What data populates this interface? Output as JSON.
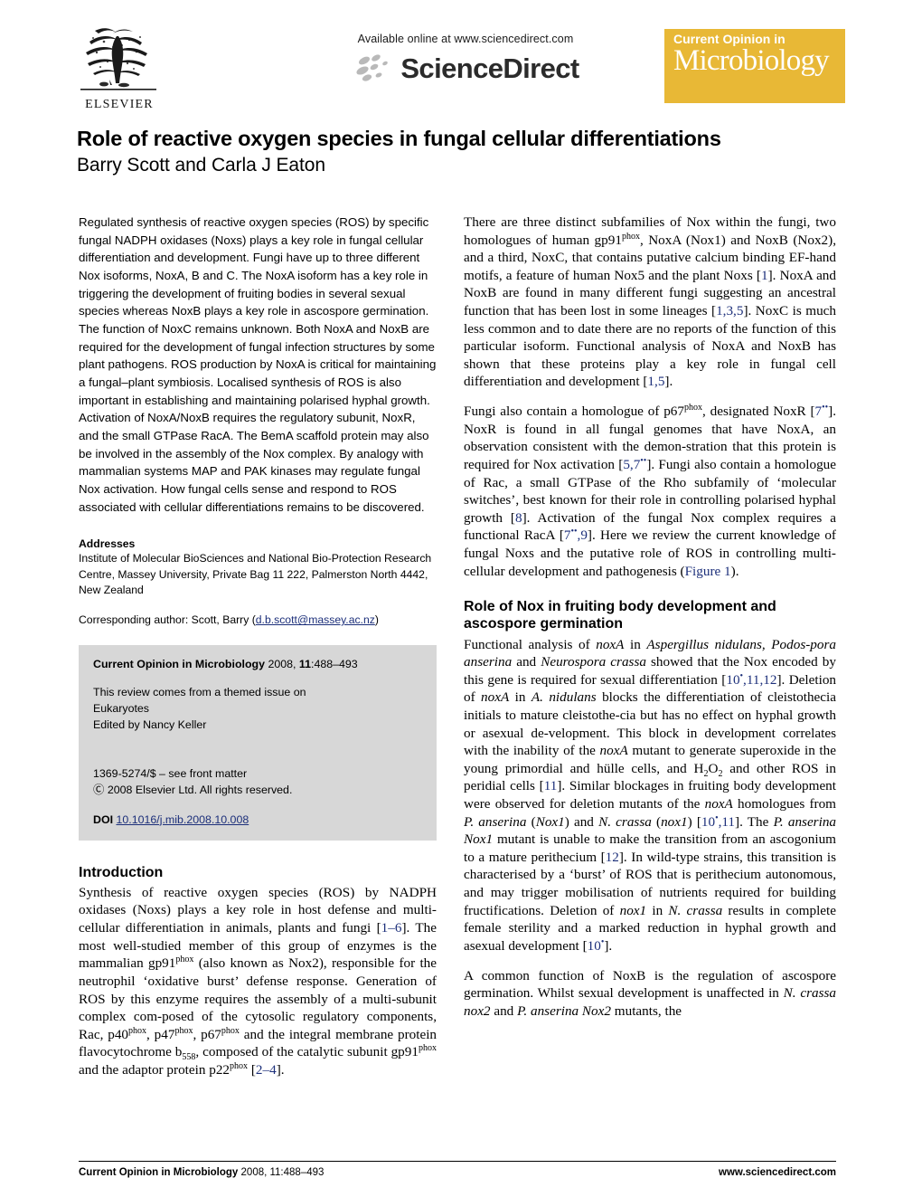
{
  "masthead": {
    "publisher": "ELSEVIER",
    "available_online": "Available online at www.sciencedirect.com",
    "sciencedirect_name": "ScienceDirect",
    "journal_badge_top": "Current Opinion in",
    "journal_badge_main": "Microbiology",
    "badge_color": "#e8b836"
  },
  "article": {
    "title": "Role of reactive oxygen species in fungal cellular differentiations",
    "authors": "Barry Scott and Carla J Eaton"
  },
  "abstract": {
    "text": "Regulated synthesis of reactive oxygen species (ROS) by specific fungal NADPH oxidases (Noxs) plays a key role in fungal cellular differentiation and development. Fungi have up to three different Nox isoforms, NoxA, B and C. The NoxA isoform has a key role in triggering the development of fruiting bodies in several sexual species whereas NoxB plays a key role in ascospore germination. The function of NoxC remains unknown. Both NoxA and NoxB are required for the development of fungal infection structures by some plant pathogens. ROS production by NoxA is critical for maintaining a fungal–plant symbiosis. Localised synthesis of ROS is also important in establishing and maintaining polarised hyphal growth. Activation of NoxA/NoxB requires the regulatory subunit, NoxR, and the small GTPase RacA. The BemA scaffold protein may also be involved in the assembly of the Nox complex. By analogy with mammalian systems MAP and PAK kinases may regulate fungal Nox activation. How fungal cells sense and respond to ROS associated with cellular differentiations remains to be discovered."
  },
  "addresses": {
    "heading": "Addresses",
    "body": "Institute of Molecular BioSciences and National Bio-Protection Research Centre, Massey University, Private Bag 11 222, Palmerston North 4442, New Zealand",
    "corresponding_prefix": "Corresponding author: Scott, Barry (",
    "corresponding_email": "d.b.scott@massey.ac.nz",
    "corresponding_suffix": ")"
  },
  "info_box": {
    "journal_name": "Current Opinion in Microbiology",
    "journal_citation_year": "2008,",
    "journal_volume": "11",
    "journal_pages": ":488–493",
    "themed_line1": "This review comes from a themed issue on",
    "themed_line2": "Eukaryotes",
    "themed_line3": "Edited by Nancy Keller",
    "front_matter": "1369-5274/$ – see front matter",
    "copyright": "Ⓒ 2008 Elsevier Ltd. All rights reserved.",
    "doi_label": "DOI",
    "doi_value": "10.1016/j.mib.2008.10.008"
  },
  "sections": {
    "introduction_heading": "Introduction",
    "nox_fruiting_heading_line1": "Role of Nox in fruiting body development and",
    "nox_fruiting_heading_line2": "ascospore germination"
  },
  "footer": {
    "left_journal": "Current Opinion in Microbiology",
    "left_citation": " 2008, 11:488–493",
    "right": "www.sciencedirect.com"
  }
}
